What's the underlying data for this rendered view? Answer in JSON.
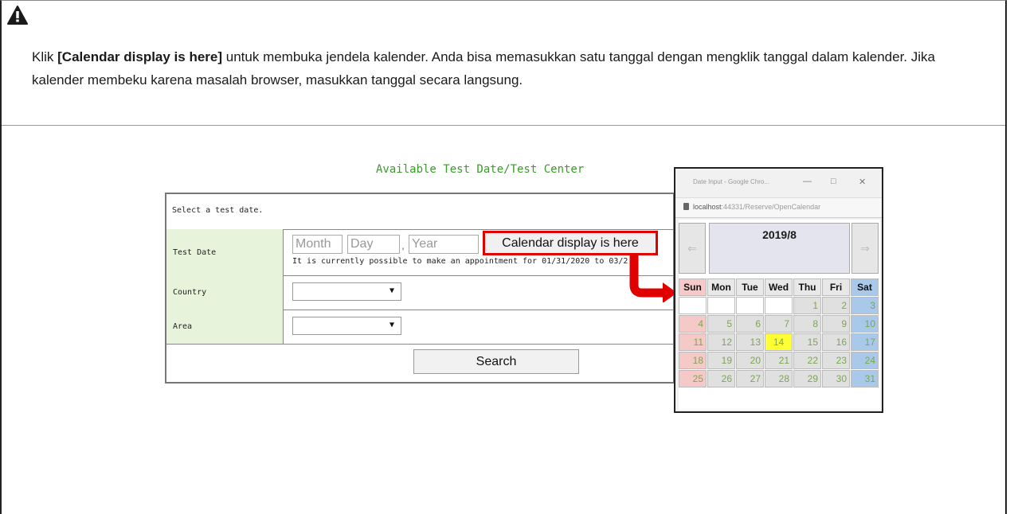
{
  "instruction": {
    "prefix": "Klik ",
    "bold": "[Calendar display is here]",
    "suffix": " untuk membuka jendela kalender. Anda bisa memasukkan satu tanggal dengan mengklik tanggal dalam kalender. Jika kalender membeku karena masalah browser, masukkan tanggal secara langsung."
  },
  "form": {
    "title": "Available Test Date/Test Center",
    "select_prompt": "Select a test date.",
    "test_date_label": "Test Date",
    "month_placeholder": "Month",
    "day_placeholder": "Day",
    "separator": ",",
    "year_placeholder": "Year",
    "calendar_button": "Calendar display is here",
    "appointment_note": "It is currently possible to make an appointment for 01/31/2020 to 03/2",
    "country_label": "Country",
    "area_label": "Area",
    "search_button": "Search"
  },
  "calendar": {
    "window_title": "Date Input - Google Chro...",
    "url_host": "localhost",
    "url_rest": ":44331/Reserve/OpenCalendar",
    "month": "2019/8",
    "prev_arrow": "⇐",
    "next_arrow": "⇒",
    "weekdays": [
      "Sun",
      "Mon",
      "Tue",
      "Wed",
      "Thu",
      "Fri",
      "Sat"
    ],
    "weeks": [
      [
        "",
        "",
        "",
        "",
        "1",
        "2",
        "3"
      ],
      [
        "4",
        "5",
        "6",
        "7",
        "8",
        "9",
        "10"
      ],
      [
        "11",
        "12",
        "13",
        "14",
        "15",
        "16",
        "17"
      ],
      [
        "18",
        "19",
        "20",
        "21",
        "22",
        "23",
        "24"
      ],
      [
        "25",
        "26",
        "27",
        "28",
        "29",
        "30",
        "31"
      ]
    ],
    "today": "14"
  },
  "colors": {
    "title_green": "#3a9a2a",
    "label_bg": "#e8f3dc",
    "highlight_red": "#e00000",
    "sunday": "#f6c9c9",
    "saturday": "#a9c9ea",
    "today": "#ffff33"
  },
  "icons": [
    "warning-icon",
    "dropdown-arrow-icon",
    "lock-icon",
    "red-arrow-icon"
  ]
}
